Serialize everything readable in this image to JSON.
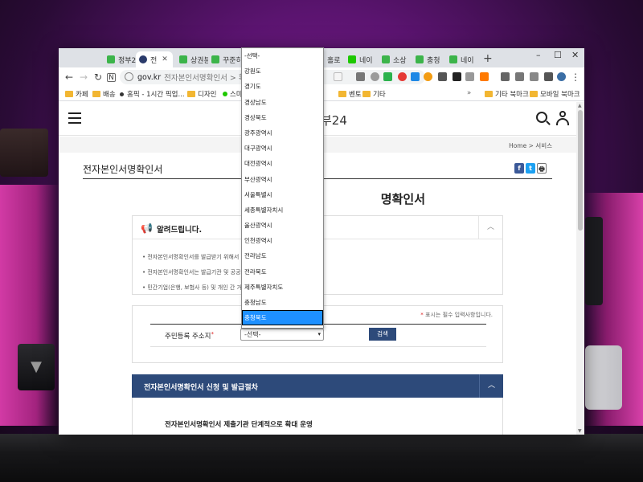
{
  "browser": {
    "tabs": [
      {
        "label": "정부2",
        "color": "#3cb44a"
      },
      {
        "label": "전",
        "color": "#2b3b6b"
      },
      {
        "label": "상권분",
        "color": "#3cb44a"
      },
      {
        "label": "꾸준히",
        "color": "#3cb44a"
      },
      {
        "label": "홀로",
        "color": "#3cb44a"
      },
      {
        "label": "네이",
        "color": "#1ec800"
      },
      {
        "label": "소상",
        "color": "#3cb44a"
      },
      {
        "label": "충청",
        "color": "#3cb44a"
      },
      {
        "label": "네이",
        "color": "#3cb44a"
      }
    ],
    "tab_close": "✕",
    "new_tab": "+",
    "window_controls": {
      "minimize": "–",
      "maximize": "☐",
      "close": "✕"
    },
    "address": {
      "domain": "gov.kr",
      "path": "전자본인서명확인서 > 확"
    },
    "bookmarks": [
      {
        "label": "카페",
        "type": "folder"
      },
      {
        "label": "배송",
        "type": "folder"
      },
      {
        "label": "홈픽 - 1시간 픽업...",
        "type": "link"
      },
      {
        "label": "디자인",
        "type": "folder"
      },
      {
        "label": "스마",
        "type": "link"
      },
      {
        "label": "벤토",
        "type": "folder"
      },
      {
        "label": "기타",
        "type": "folder"
      }
    ],
    "bookmarks_right": [
      {
        "label": "기타 북마크"
      },
      {
        "label": "모바일 북마크"
      }
    ],
    "bookmarks_overflow": "»"
  },
  "site": {
    "logo_text": "부24",
    "breadcrumb": {
      "home": "Home",
      "sep": ">",
      "current": "서비스"
    },
    "page_title": "전자본인서명확인서",
    "share_icons": [
      "f",
      "t",
      "🖶"
    ],
    "big_title": "명확인서",
    "notice": {
      "heading": "알려드립니다.",
      "toggle": "︿",
      "items": [
        "전자본인서명확인서를 발급받기 위해서                                               이용신청 후 가능합니다.",
        "전자본인서명확인서는 발급기관 및 공공",
        "민간기업(은행, 보험사 등) 및 개인 간 거                                              이용"
      ]
    },
    "form": {
      "required_note": "표시는 필수 입력사항입니다.",
      "required_star": "*",
      "field_label": "주민등록 주소지",
      "select_value": "-선택-",
      "select_caret": "▾",
      "search_button": "검색"
    },
    "accordion": {
      "title": "전자본인서명확인서 신청 및 발급절차",
      "toggle": "︿",
      "subtitle": "전자본인서명확인서 제출기관 단계적으로 확대 운영"
    }
  },
  "dropdown": {
    "options": [
      "-선택-",
      "강원도",
      "경기도",
      "경상남도",
      "경상북도",
      "광주광역시",
      "대구광역시",
      "대전광역시",
      "부산광역시",
      "서울특별시",
      "세종특별자치시",
      "울산광역시",
      "인천광역시",
      "전라남도",
      "전라북도",
      "제주특별자치도",
      "충청남도",
      "충청북도"
    ],
    "highlighted": "충청북도"
  },
  "colors": {
    "gov_navy": "#2d4a7a",
    "dropdown_highlight": "#1e90ff",
    "required_red": "#d22"
  }
}
